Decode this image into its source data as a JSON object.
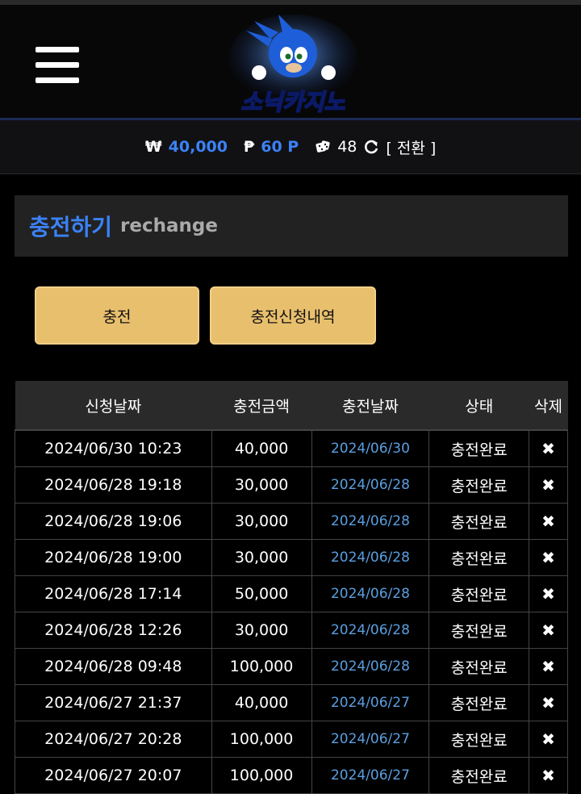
{
  "header": {
    "menu_icon": "hamburger-icon",
    "logo_text": "소닉카지노"
  },
  "wallet": {
    "won_symbol": "₩",
    "won_value": "40,000",
    "point_symbol": "₱",
    "point_value": "60 P",
    "dice_icon": "dice-icon",
    "dice_value": "48",
    "refresh_icon": "refresh-icon",
    "switch_label": "[ 전환 ]"
  },
  "section": {
    "title": "충전하기",
    "subtitle": "rechange"
  },
  "buttons": {
    "charge": "충전",
    "history": "충전신청내역"
  },
  "table": {
    "headers": [
      "신청날짜",
      "충전금액",
      "충전날짜",
      "상태",
      "삭제"
    ],
    "rows": [
      {
        "req": "2024/06/30 10:23",
        "amount": "40,000",
        "date": "2024/06/30",
        "status": "충전완료",
        "del": "✖"
      },
      {
        "req": "2024/06/28 19:18",
        "amount": "30,000",
        "date": "2024/06/28",
        "status": "충전완료",
        "del": "✖"
      },
      {
        "req": "2024/06/28 19:06",
        "amount": "30,000",
        "date": "2024/06/28",
        "status": "충전완료",
        "del": "✖"
      },
      {
        "req": "2024/06/28 19:00",
        "amount": "30,000",
        "date": "2024/06/28",
        "status": "충전완료",
        "del": "✖"
      },
      {
        "req": "2024/06/28 17:14",
        "amount": "50,000",
        "date": "2024/06/28",
        "status": "충전완료",
        "del": "✖"
      },
      {
        "req": "2024/06/28 12:26",
        "amount": "30,000",
        "date": "2024/06/28",
        "status": "충전완료",
        "del": "✖"
      },
      {
        "req": "2024/06/28 09:48",
        "amount": "100,000",
        "date": "2024/06/28",
        "status": "충전완료",
        "del": "✖"
      },
      {
        "req": "2024/06/27 21:37",
        "amount": "40,000",
        "date": "2024/06/27",
        "status": "충전완료",
        "del": "✖"
      },
      {
        "req": "2024/06/27 20:28",
        "amount": "100,000",
        "date": "2024/06/27",
        "status": "충전완료",
        "del": "✖"
      },
      {
        "req": "2024/06/27 20:07",
        "amount": "100,000",
        "date": "2024/06/27",
        "status": "충전완료",
        "del": "✖"
      }
    ]
  },
  "colors": {
    "accent": "#3b82f6",
    "button_gold": "#e8bf6d"
  }
}
